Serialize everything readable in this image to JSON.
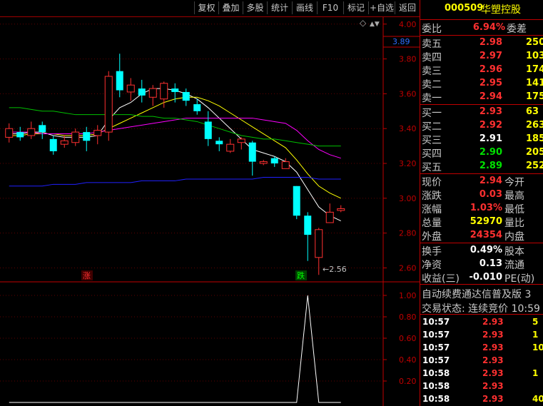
{
  "toolbar": [
    "复权",
    "叠加",
    "多股",
    "统计",
    "画线",
    "F10",
    "标记",
    "+自选",
    "返回"
  ],
  "chart": {
    "price_ticks": [
      "4.00",
      "3.80",
      "3.60",
      "3.40",
      "3.20",
      "3.00",
      "2.80",
      "2.60"
    ],
    "current_price_badge": "3.89",
    "low_marker": "←2.56",
    "up_marker": "涨",
    "down_marker": "跌",
    "indicator_ticks": [
      "1.00",
      "0.80",
      "0.60",
      "0.40",
      "0.20"
    ],
    "settings_glyph": "◇",
    "arrow_glyph": "▲▼",
    "colors": {
      "up": "#ff3030",
      "down": "#00ffff",
      "ma1": "#ffffff",
      "ma2": "#ffff00",
      "ma3": "#ff00ff",
      "ma4": "#00c000",
      "ma5": "#2020ff"
    }
  },
  "chart_data": {
    "type": "candlestick",
    "ylim": [
      2.52,
      4.04
    ],
    "candles": [
      {
        "o": 3.35,
        "c": 3.4,
        "h": 3.43,
        "l": 3.32
      },
      {
        "o": 3.38,
        "c": 3.35,
        "h": 3.41,
        "l": 3.33
      },
      {
        "o": 3.36,
        "c": 3.4,
        "h": 3.44,
        "l": 3.34
      },
      {
        "o": 3.42,
        "c": 3.38,
        "h": 3.44,
        "l": 3.34
      },
      {
        "o": 3.34,
        "c": 3.27,
        "h": 3.36,
        "l": 3.25
      },
      {
        "o": 3.31,
        "c": 3.33,
        "h": 3.36,
        "l": 3.29
      },
      {
        "o": 3.32,
        "c": 3.38,
        "h": 3.4,
        "l": 3.3
      },
      {
        "o": 3.38,
        "c": 3.33,
        "h": 3.41,
        "l": 3.27
      },
      {
        "o": 3.36,
        "c": 3.39,
        "h": 3.42,
        "l": 3.31
      },
      {
        "o": 3.38,
        "c": 3.7,
        "h": 3.73,
        "l": 3.33
      },
      {
        "o": 3.73,
        "c": 3.62,
        "h": 3.83,
        "l": 3.58
      },
      {
        "o": 3.61,
        "c": 3.65,
        "h": 3.69,
        "l": 3.56
      },
      {
        "o": 3.63,
        "c": 3.59,
        "h": 3.68,
        "l": 3.55
      },
      {
        "o": 3.58,
        "c": 3.63,
        "h": 3.65,
        "l": 3.53
      },
      {
        "o": 3.57,
        "c": 3.66,
        "h": 3.67,
        "l": 3.52
      },
      {
        "o": 3.63,
        "c": 3.61,
        "h": 3.66,
        "l": 3.55
      },
      {
        "o": 3.61,
        "c": 3.56,
        "h": 3.63,
        "l": 3.53
      },
      {
        "o": 3.54,
        "c": 3.5,
        "h": 3.57,
        "l": 3.48
      },
      {
        "o": 3.44,
        "c": 3.34,
        "h": 3.5,
        "l": 3.3
      },
      {
        "o": 3.33,
        "c": 3.31,
        "h": 3.35,
        "l": 3.27
      },
      {
        "o": 3.27,
        "c": 3.31,
        "h": 3.34,
        "l": 3.26
      },
      {
        "o": 3.32,
        "c": 3.34,
        "h": 3.35,
        "l": 3.28
      },
      {
        "o": 3.32,
        "c": 3.21,
        "h": 3.33,
        "l": 3.13
      },
      {
        "o": 3.2,
        "c": 3.21,
        "h": 3.22,
        "l": 3.19
      },
      {
        "o": 3.23,
        "c": 3.2,
        "h": 3.24,
        "l": 3.18
      },
      {
        "o": 3.17,
        "c": 3.21,
        "h": 3.23,
        "l": 3.17
      },
      {
        "o": 3.07,
        "c": 2.9,
        "h": 3.07,
        "l": 2.88
      },
      {
        "o": 2.9,
        "c": 2.79,
        "h": 2.92,
        "l": 2.64
      },
      {
        "o": 2.66,
        "c": 2.82,
        "h": 2.83,
        "l": 2.56
      },
      {
        "o": 2.86,
        "c": 2.92,
        "h": 2.97,
        "l": 2.86
      },
      {
        "o": 2.93,
        "c": 2.94,
        "h": 2.96,
        "l": 2.92
      }
    ],
    "ma_lines": [
      {
        "name": "ma1",
        "values": [
          3.37,
          3.37,
          3.38,
          3.38,
          3.36,
          3.35,
          3.35,
          3.35,
          3.36,
          3.45,
          3.52,
          3.55,
          3.6,
          3.63,
          3.63,
          3.62,
          3.6,
          3.57,
          3.52,
          3.46,
          3.4,
          3.34,
          3.28,
          3.26,
          3.24,
          3.21,
          3.15,
          3.05,
          2.95,
          2.9,
          2.87
        ]
      },
      {
        "name": "ma2",
        "values": [
          3.36,
          3.36,
          3.37,
          3.37,
          3.37,
          3.36,
          3.36,
          3.36,
          3.37,
          3.4,
          3.43,
          3.46,
          3.49,
          3.52,
          3.55,
          3.57,
          3.58,
          3.58,
          3.56,
          3.53,
          3.49,
          3.45,
          3.41,
          3.37,
          3.33,
          3.29,
          3.22,
          3.14,
          3.07,
          3.03,
          3.0
        ]
      },
      {
        "name": "ma3",
        "values": [
          3.38,
          3.38,
          3.38,
          3.37,
          3.37,
          3.37,
          3.37,
          3.37,
          3.38,
          3.39,
          3.4,
          3.41,
          3.42,
          3.43,
          3.44,
          3.45,
          3.46,
          3.46,
          3.46,
          3.46,
          3.46,
          3.46,
          3.46,
          3.45,
          3.44,
          3.43,
          3.39,
          3.33,
          3.28,
          3.25,
          3.23
        ]
      },
      {
        "name": "ma4",
        "values": [
          3.52,
          3.52,
          3.51,
          3.5,
          3.5,
          3.49,
          3.48,
          3.48,
          3.48,
          3.48,
          3.48,
          3.48,
          3.47,
          3.47,
          3.46,
          3.46,
          3.45,
          3.44,
          3.42,
          3.4,
          3.38,
          3.36,
          3.35,
          3.34,
          3.34,
          3.33,
          3.32,
          3.31,
          3.3,
          3.3,
          3.3
        ]
      },
      {
        "name": "ma5",
        "values": [
          3.07,
          3.07,
          3.07,
          3.07,
          3.08,
          3.08,
          3.08,
          3.09,
          3.09,
          3.09,
          3.09,
          3.09,
          3.1,
          3.1,
          3.1,
          3.1,
          3.11,
          3.11,
          3.11,
          3.11,
          3.11,
          3.11,
          3.11,
          3.12,
          3.12,
          3.12,
          3.12,
          3.12,
          3.11,
          3.11,
          3.11
        ]
      }
    ],
    "indicator": {
      "values": [
        0,
        0,
        0,
        0,
        0,
        0,
        0,
        0,
        0,
        0,
        0,
        0,
        0,
        0,
        0,
        0,
        0,
        0,
        0,
        0,
        0,
        0,
        0,
        0,
        0,
        0,
        0,
        1,
        0,
        0,
        0
      ],
      "ylim": [
        0,
        1.08
      ]
    }
  },
  "panel": {
    "code": "000509",
    "name": "华塑控股",
    "weibi_label": "委比",
    "weibi_val": "6.94%",
    "weicha_label": "委差",
    "asks": [
      {
        "label": "卖五",
        "price": "2.98",
        "vol": "250"
      },
      {
        "label": "卖四",
        "price": "2.97",
        "vol": "103"
      },
      {
        "label": "卖三",
        "price": "2.96",
        "vol": "174"
      },
      {
        "label": "卖二",
        "price": "2.95",
        "vol": "141"
      },
      {
        "label": "卖一",
        "price": "2.94",
        "vol": "175"
      }
    ],
    "bids": [
      {
        "label": "买一",
        "price": "2.93",
        "vol": "63"
      },
      {
        "label": "买二",
        "price": "2.92",
        "vol": "263"
      },
      {
        "label": "买三",
        "price": "2.91",
        "vol": "185"
      },
      {
        "label": "买四",
        "price": "2.90",
        "vol": "205"
      },
      {
        "label": "买五",
        "price": "2.89",
        "vol": "252"
      }
    ],
    "stats": [
      {
        "l1": "现价",
        "v1": "2.94",
        "l2": "今开"
      },
      {
        "l1": "涨跌",
        "v1": "0.03",
        "l2": "最高"
      },
      {
        "l1": "涨幅",
        "v1": "1.03%",
        "l2": "最低"
      },
      {
        "l1": "总量",
        "v1": "52970",
        "l2": "量比"
      },
      {
        "l1": "外盘",
        "v1": "24354",
        "l2": "内盘"
      }
    ],
    "stats2": [
      {
        "l1": "换手",
        "v1": "0.49%",
        "l2": "股本"
      },
      {
        "l1": "净资",
        "v1": "0.13",
        "l2": "流通"
      },
      {
        "l1": "收益(三)",
        "v1": "-0.010",
        "l2": "PE(动)"
      }
    ],
    "notice": "自动续费通达信普及版 3",
    "trade_status": "交易状态: 连续竞价 10:59",
    "ticks": [
      {
        "t": "10:57",
        "p": "2.93",
        "v": "5"
      },
      {
        "t": "10:57",
        "p": "2.93",
        "v": "1"
      },
      {
        "t": "10:57",
        "p": "2.93",
        "v": "10"
      },
      {
        "t": "10:57",
        "p": "2.93",
        "v": ""
      },
      {
        "t": "10:58",
        "p": "2.93",
        "v": "1"
      },
      {
        "t": "10:58",
        "p": "2.93",
        "v": ""
      },
      {
        "t": "10:58",
        "p": "2.93",
        "v": "40"
      }
    ]
  }
}
